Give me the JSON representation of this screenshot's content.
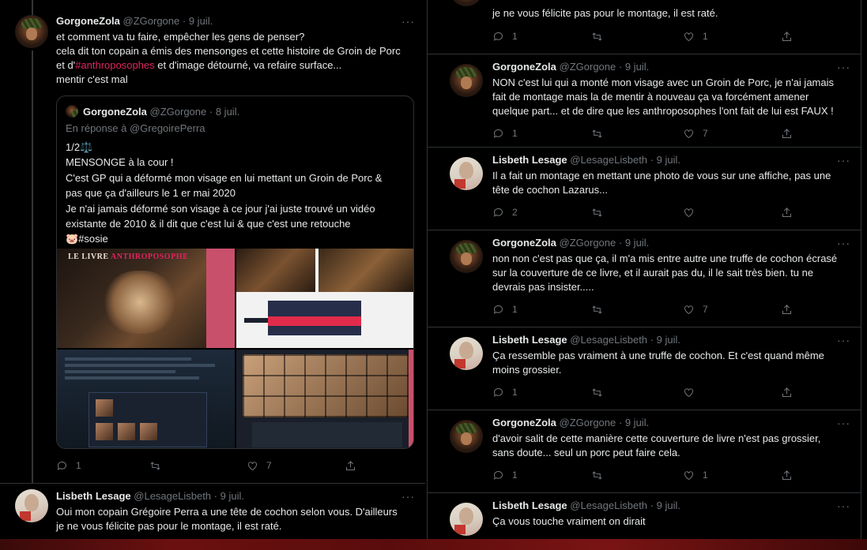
{
  "left": {
    "main_tweet": {
      "name": "GorgoneZola",
      "handle": "@ZGorgone",
      "date": "9 juil.",
      "text_before": "et comment va tu faire, empêcher les gens de penser?\ncela dit ton copain a émis des mensonges et cette histoire de Groin de Porc\net d'",
      "hashtag": "#anthroposophes",
      "text_after": " et d'image détourné, va refaire surface...\nmentir c'est mal",
      "quote": {
        "name": "GorgoneZola",
        "handle": "@ZGorgone",
        "date": "8 juil.",
        "reply_to": "En réponse à @GregoirePerra",
        "text": "1/2⚖️\nMENSONGE à la cour !\nC'est GP qui a déformé mon visage en lui mettant un Groin de Porc &\npas que ça d'ailleurs le 1 er mai 2020\nJe n'ai jamais déformé son visage à ce jour j'ai juste trouvé un vidéo\nexistante de 2010 & il dit que c'est lui & que c'est une retouche\n🐷#sosie",
        "media_title_a": "LE LIVRE ",
        "media_title_b": "ANTHROPOSOPHE"
      },
      "replies": "1",
      "retweets": "",
      "likes": "7"
    },
    "reply_tweet": {
      "name": "Lisbeth Lesage",
      "handle": "@LesageLisbeth",
      "date": "9 juil.",
      "text": "Oui mon copain Grégoire Perra a une tête de cochon selon vous. D'ailleurs\nje ne vous félicite pas pour le montage, il est raté."
    }
  },
  "right": {
    "top_partial": {
      "text": "je ne vous félicite pas pour le montage, il est raté.",
      "replies": "1",
      "likes": "1"
    },
    "tweets": [
      {
        "name": "GorgoneZola",
        "handle": "@ZGorgone",
        "date": "9 juil.",
        "avatar": "gorgone",
        "text": "NON c'est lui qui a monté mon visage avec un Groin de Porc, je n'ai jamais\nfait de montage mais la de mentir à nouveau ça va forcément amener\nquelque part... et de dire que les anthroposophes l'ont fait de lui est FAUX !",
        "replies": "1",
        "likes": "7"
      },
      {
        "name": "Lisbeth Lesage",
        "handle": "@LesageLisbeth",
        "date": "9 juil.",
        "avatar": "lisbeth",
        "text": "Il a fait un montage en mettant une photo de vous sur une affiche, pas une\ntête de cochon Lazarus...",
        "replies": "2",
        "likes": ""
      },
      {
        "name": "GorgoneZola",
        "handle": "@ZGorgone",
        "date": "9 juil.",
        "avatar": "gorgone",
        "text": "non non c'est pas que ça, il m'a mis entre autre une truffe de cochon écrasé\nsur la couverture de ce livre, et il aurait pas du, il le sait très bien. tu ne\ndevrais pas insister.....",
        "replies": "1",
        "likes": "7"
      },
      {
        "name": "Lisbeth Lesage",
        "handle": "@LesageLisbeth",
        "date": "9 juil.",
        "avatar": "lisbeth",
        "text": "Ça ressemble pas vraiment à une truffe de cochon. Et c'est quand même\nmoins grossier.",
        "replies": "1",
        "likes": ""
      },
      {
        "name": "GorgoneZola",
        "handle": "@ZGorgone",
        "date": "9 juil.",
        "avatar": "gorgone",
        "text": "d'avoir salit de cette manière cette couverture de livre n'est pas grossier,\nsans doute... seul un porc peut faire cela.",
        "replies": "1",
        "likes": "1"
      },
      {
        "name": "Lisbeth Lesage",
        "handle": "@LesageLisbeth",
        "date": "9 juil.",
        "avatar": "lisbeth",
        "text": "Ça vous touche vraiment on dirait",
        "replies": "",
        "likes": ""
      }
    ]
  },
  "icons": {
    "reply": "reply-icon",
    "retweet": "retweet-icon",
    "like": "heart-icon",
    "share": "share-icon",
    "more": "more-icon"
  },
  "colors": {
    "background": "#000000",
    "text": "#e7e9ea",
    "muted": "#71767b",
    "hashtag": "#e0245e",
    "border": "#2f3336"
  }
}
